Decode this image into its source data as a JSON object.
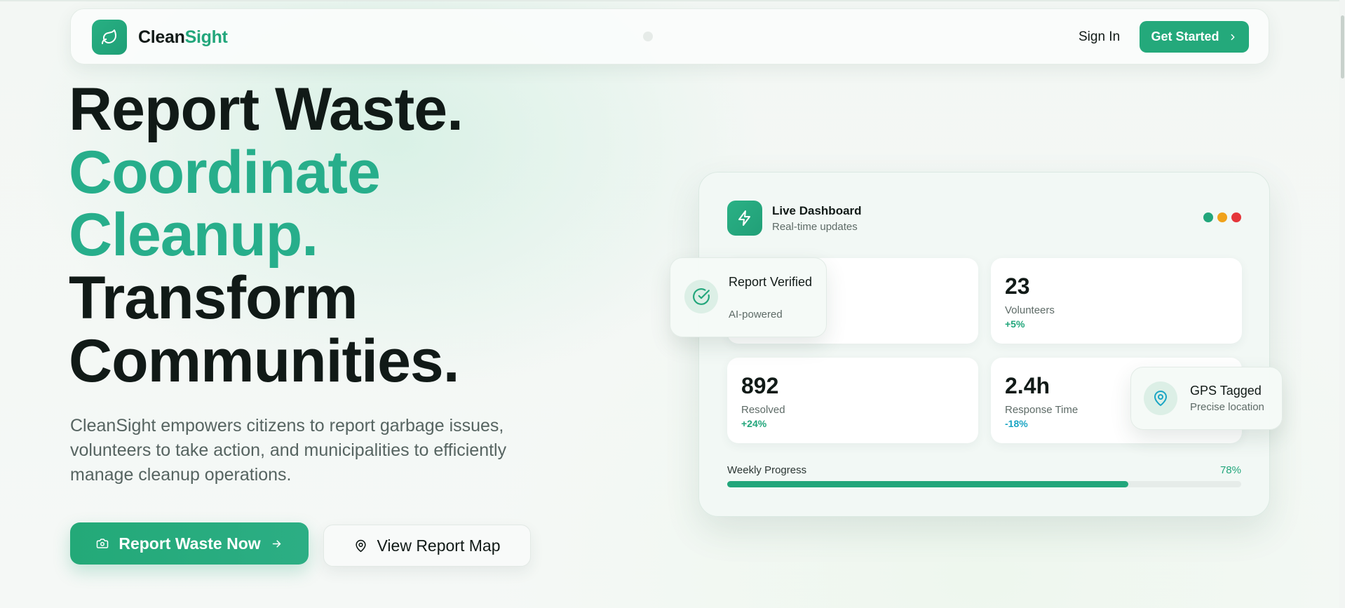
{
  "nav": {
    "brand_part1": "Clean",
    "brand_part2": "Sight",
    "signin": "Sign In",
    "get_started": "Get Started"
  },
  "hero": {
    "line1": "Report Waste.",
    "line2": "Coordinate",
    "line3": "Cleanup.",
    "line4": "Transform",
    "line5": "Communities.",
    "subtitle": "CleanSight empowers citizens to report garbage issues, volunteers to take action, and municipalities to efficiently manage cleanup operations.",
    "primary_button": "Report Waste Now",
    "secondary_button": "View Report Map"
  },
  "dashboard": {
    "title": "Live Dashboard",
    "subtitle": "Real-time updates",
    "lights": [
      "#22a67b",
      "#f0a21b",
      "#e5363a"
    ],
    "stats": [
      {
        "value": "",
        "label": "",
        "change": "",
        "change_color": "#22a67b"
      },
      {
        "value": "23",
        "label": "Volunteers",
        "change": "+5%",
        "change_color": "#22a67b"
      },
      {
        "value": "892",
        "label": "Resolved",
        "change": "+24%",
        "change_color": "#22a67b"
      },
      {
        "value": "2.4h",
        "label": "Response Time",
        "change": "-18%",
        "change_color": "#1aa5c4"
      }
    ],
    "progress_label": "Weekly Progress",
    "progress_text": "78%",
    "progress_value": 0.78
  },
  "floating": {
    "verified_title": "Report Verified",
    "verified_sub": "AI-powered",
    "gps_title": "GPS Tagged",
    "gps_sub": "Precise location"
  },
  "colors": {
    "accent": "#22a67b",
    "heading_accent": "#27ae8b",
    "text_dark": "#111a17"
  },
  "icons": {
    "logo": "leaf-icon",
    "dashboard": "bolt-icon",
    "verified": "check-circle-icon",
    "gps": "map-pin-icon",
    "report_button": "camera-icon",
    "map_button": "map-pin-icon",
    "arrows": "arrow-right-icon"
  }
}
